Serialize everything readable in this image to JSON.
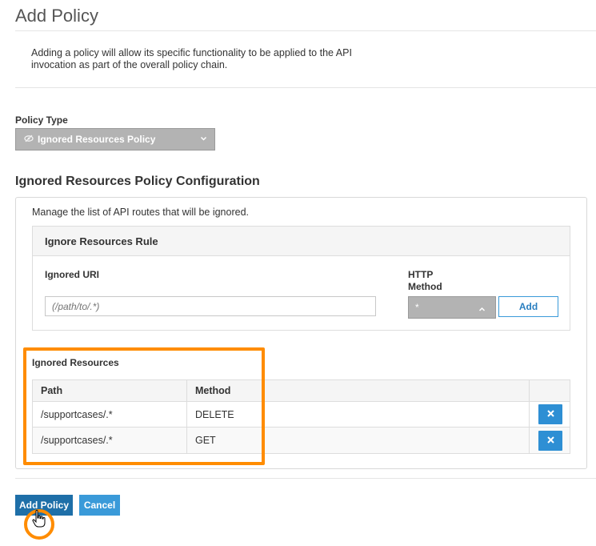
{
  "page": {
    "title": "Add Policy",
    "intro": "Adding a policy will allow its specific functionality to be applied to the API invocation as part of the overall policy chain."
  },
  "policy_type": {
    "label": "Policy Type",
    "selected": "Ignored Resources Policy",
    "icon": "eye-slash-icon"
  },
  "config": {
    "title": "Ignored Resources Policy Configuration",
    "description": "Manage the list of API routes that will be ignored.",
    "rule_panel": {
      "title": "Ignore Resources Rule",
      "uri_label": "Ignored URI",
      "uri_placeholder": "(/path/to/.*)",
      "method_label_line1": "HTTP",
      "method_label_line2": "Method",
      "method_selected": "*",
      "add_label": "Add"
    },
    "ignored_resources": {
      "title": "Ignored Resources",
      "columns": [
        "Path",
        "Method"
      ],
      "rows": [
        {
          "path": "/supportcases/.*",
          "method": "DELETE"
        },
        {
          "path": "/supportcases/.*",
          "method": "GET"
        }
      ]
    }
  },
  "actions": {
    "add_policy": "Add Policy",
    "cancel": "Cancel"
  },
  "colors": {
    "highlight": "#ff8c00",
    "primary": "#1e6fa8",
    "accent": "#3a9ad9"
  }
}
